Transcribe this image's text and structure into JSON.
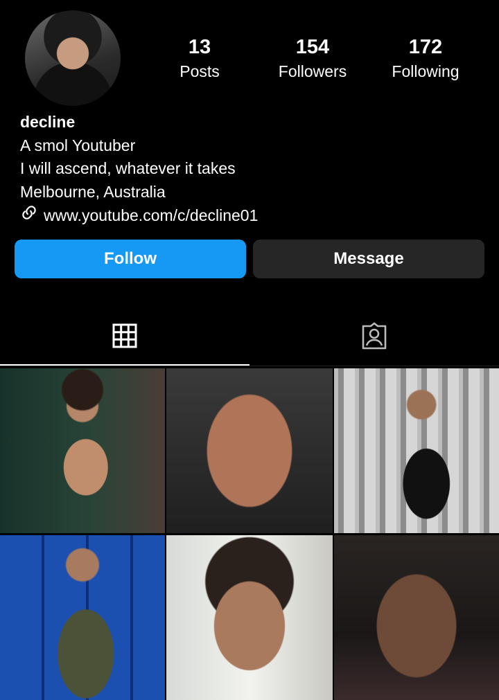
{
  "profile": {
    "username": "decline",
    "bio_lines": [
      "A smol Youtuber",
      "I will ascend, whatever it takes",
      "Melbourne, Australia"
    ],
    "link": "www.youtube.com/c/decline01"
  },
  "stats": {
    "posts": {
      "value": "13",
      "label": "Posts"
    },
    "followers": {
      "value": "154",
      "label": "Followers"
    },
    "following": {
      "value": "172",
      "label": "Following"
    }
  },
  "actions": {
    "follow_label": "Follow",
    "message_label": "Message",
    "follow_color": "#1698f5",
    "message_color": "#262626"
  },
  "tabs": [
    {
      "icon": "grid-icon",
      "active": true
    },
    {
      "icon": "tagged-person-icon",
      "active": false
    }
  ],
  "posts": [
    {
      "icon": "post-photo"
    },
    {
      "icon": "post-photo"
    },
    {
      "icon": "post-photo"
    },
    {
      "icon": "post-photo"
    },
    {
      "icon": "post-photo"
    },
    {
      "icon": "post-photo"
    }
  ]
}
